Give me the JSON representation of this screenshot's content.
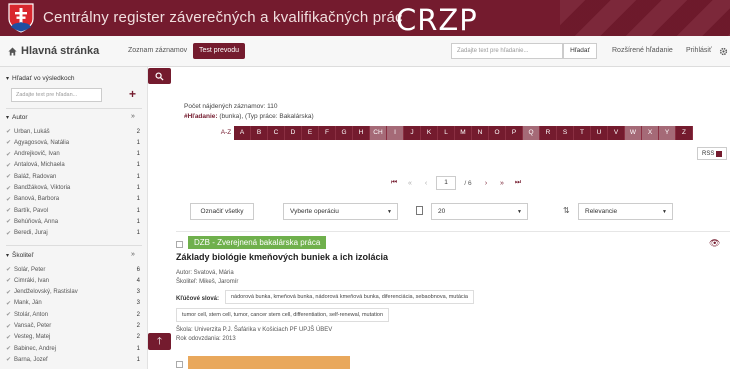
{
  "banner": {
    "title": "Centrálny register záverečných a kvalifikačných prác",
    "brand": "CRZP"
  },
  "nav": {
    "home": "Hlavná stránka",
    "list_link": "Zoznam záznamov",
    "test_button": "Test prevodu",
    "search_placeholder": "Zadajte text pre hľadanie...",
    "search_button": "Hľadať",
    "advanced_link": "Rozšírené hľadanie",
    "login_link": "Prihlásiť"
  },
  "sidebar": {
    "search_heading": "Hľadať vo výsledkoch",
    "search_placeholder": "Zadajte text pre hľadan...",
    "author_heading": "Autor",
    "authors": [
      {
        "name": "Urban, Lukáš",
        "count": "2"
      },
      {
        "name": "Agyagosová, Natália",
        "count": "1"
      },
      {
        "name": "Andrejkovič, Ivan",
        "count": "1"
      },
      {
        "name": "Antalová, Michaela",
        "count": "1"
      },
      {
        "name": "Baláž, Radovan",
        "count": "1"
      },
      {
        "name": "Bandžáková, Viktoria",
        "count": "1"
      },
      {
        "name": "Banová, Barbora",
        "count": "1"
      },
      {
        "name": "Bartík, Pavol",
        "count": "1"
      },
      {
        "name": "Behúňová, Anna",
        "count": "1"
      },
      {
        "name": "Beredi, Juraj",
        "count": "1"
      }
    ],
    "supervisor_heading": "Školiteľ",
    "supervisors": [
      {
        "name": "Solár, Peter",
        "count": "6"
      },
      {
        "name": "Cimráki, Ivan",
        "count": "4"
      },
      {
        "name": "Jendželovský, Rastislav",
        "count": "3"
      },
      {
        "name": "Mank, Ján",
        "count": "3"
      },
      {
        "name": "Stolár, Anton",
        "count": "2"
      },
      {
        "name": "Vansač, Peter",
        "count": "2"
      },
      {
        "name": "Vesteg, Matej",
        "count": "2"
      },
      {
        "name": "Babinec, Andrej",
        "count": "1"
      },
      {
        "name": "Barna, Jozef",
        "count": "1"
      }
    ]
  },
  "main": {
    "count_text": "Počet nájdených záznamov: 110",
    "query_label": "#Hľadanie:",
    "query_text": " (bunka), (Typ práce: Bakalárska)",
    "alpha_label": "A-Z",
    "letters": [
      "A",
      "B",
      "C",
      "D",
      "E",
      "F",
      "G",
      "H",
      "CH",
      "I",
      "J",
      "K",
      "L",
      "M",
      "N",
      "O",
      "P",
      "Q",
      "R",
      "S",
      "T",
      "U",
      "V",
      "W",
      "X",
      "Y",
      "Z"
    ],
    "disabled_letters": [
      "CH",
      "I",
      "Q",
      "W",
      "X",
      "Y"
    ],
    "rss": "RSS",
    "pager": {
      "current": "1",
      "total": "/ 6"
    },
    "select_all": "Označiť všetky",
    "operation": "Vyberte operáciu",
    "page_size": "20",
    "sort": "Relevancie"
  },
  "result": {
    "badge": "DZB - Zverejnená bakalárska práca",
    "title": "Základy biológie kmeňových buniek a ich izolácia",
    "author": "Autor: Svatová, Mária",
    "supervisor": "Školiteľ: Mikeš, Jaromír",
    "keywords_label": "Kľúčové slová:",
    "keywords_line1": "nádorová bunka, kmeňová bunka, nádorová kmeňová bunka, diferenciácia, sebaobnova, mutácia",
    "keywords_line2": "tumor cell, stem cell, tumor, cancer stem cell, differentiation, self-renewal, mutation",
    "school": "Škola: Univerzita P.J. Šafárika v Košiciach PF UPJŠ ÚBEV",
    "year": "Rok odovzdania: 2013"
  },
  "colors": {
    "brand": "#741b2e",
    "badge_green": "#6fb04c",
    "badge_orange": "#e9a85c"
  }
}
